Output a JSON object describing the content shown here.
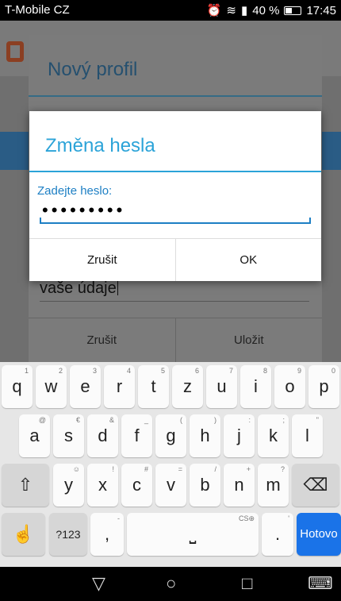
{
  "status": {
    "carrier": "T-Mobile CZ",
    "battery": "40 %",
    "time": "17:45"
  },
  "profile_dialog": {
    "title": "Nový profil",
    "field_value": "vaše údaje",
    "cancel_label": "Zrušit",
    "save_label": "Uložit"
  },
  "password_dialog": {
    "title": "Změna hesla",
    "label": "Zadejte heslo:",
    "password_mask": "•••••••••",
    "cancel_label": "Zrušit",
    "ok_label": "OK"
  },
  "keyboard": {
    "row1": [
      [
        "q",
        "1"
      ],
      [
        "w",
        "2"
      ],
      [
        "e",
        "3"
      ],
      [
        "r",
        "4"
      ],
      [
        "t",
        "5"
      ],
      [
        "z",
        "6"
      ],
      [
        "u",
        "7"
      ],
      [
        "i",
        "8"
      ],
      [
        "o",
        "9"
      ],
      [
        "p",
        "0"
      ]
    ],
    "row2": [
      [
        "a",
        "@"
      ],
      [
        "s",
        "€"
      ],
      [
        "d",
        "&"
      ],
      [
        "f",
        "_"
      ],
      [
        "g",
        "("
      ],
      [
        "h",
        ")"
      ],
      [
        "j",
        ":"
      ],
      [
        "k",
        ";"
      ],
      [
        "l",
        "\""
      ]
    ],
    "row3": [
      [
        "y",
        "☺"
      ],
      [
        "x",
        "!"
      ],
      [
        "c",
        "#"
      ],
      [
        "v",
        "="
      ],
      [
        "b",
        "/"
      ],
      [
        "n",
        "+"
      ],
      [
        "m",
        "?"
      ]
    ],
    "symbols_label": "?123",
    "comma": ",",
    "comma_hint": "-",
    "period": ".",
    "period_hint": "'",
    "space_hint": "CS⊕",
    "done_label": "Hotovo"
  },
  "colors": {
    "accent": "#2ba3d8",
    "done_key": "#1a73e8"
  }
}
